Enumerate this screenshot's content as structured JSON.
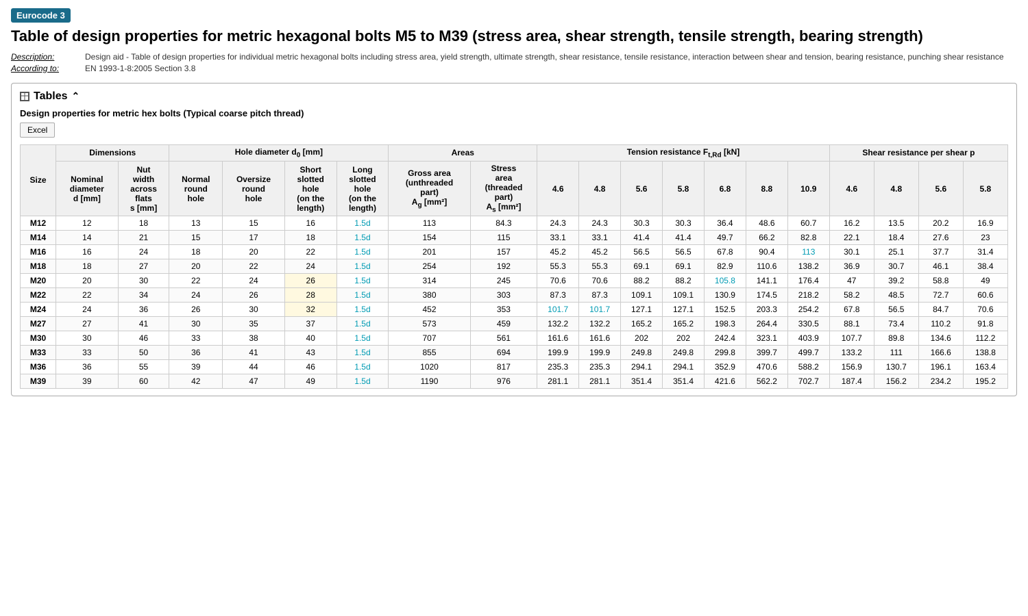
{
  "badge": "Eurocode 3",
  "title": "Table of design properties for metric hexagonal bolts M5 to M39 (stress area, shear strength, tensile strength, bearing strength)",
  "meta": {
    "description_label": "Description:",
    "description_value": "Design aid - Table of design properties for individual metric hexagonal bolts including stress area, yield strength, ultimate strength, shear resistance, tensile resistance, interaction between shear and tension, bearing resistance, punching shear resistance",
    "according_label": "According to:",
    "according_value": "EN 1993-1-8:2005 Section 3.8"
  },
  "section": {
    "header": "Tables",
    "sub_title": "Design properties for metric hex bolts (Typical coarse pitch thread)",
    "excel_button": "Excel"
  },
  "table": {
    "col_groups": [
      {
        "label": "",
        "colspan": 1
      },
      {
        "label": "Dimensions",
        "colspan": 2
      },
      {
        "label": "Hole diameter d₀ [mm]",
        "colspan": 4
      },
      {
        "label": "Areas",
        "colspan": 2
      },
      {
        "label": "Tension resistance Fₜ,Rd [kN]",
        "colspan": 7
      },
      {
        "label": "Shear resistance per shear p",
        "colspan": 4
      }
    ],
    "sub_headers": [
      "Size",
      "Nominal diameter d [mm]",
      "Nut width across flats s [mm]",
      "Normal round hole",
      "Oversize round hole",
      "Short slotted hole (on the length)",
      "Long slotted hole (on the length)",
      "Gross area (unthreaded part) Ag [mm²]",
      "Stress area (threaded part) As [mm²]",
      "4.6",
      "4.8",
      "5.6",
      "5.8",
      "6.8",
      "8.8",
      "10.9",
      "4.6",
      "4.8",
      "5.6",
      "5.8"
    ],
    "rows": [
      {
        "size": "M12",
        "d": 12,
        "s": 18,
        "normal": 13,
        "oversize": 15,
        "short": 16,
        "long": "1.5d",
        "ag": 113,
        "as_val": 84.3,
        "t46": 24.3,
        "t48": 24.3,
        "t56": 30.3,
        "t58": 30.3,
        "t68": 36.4,
        "t88": 48.6,
        "t109": 60.7,
        "s46": 16.2,
        "s48": 13.5,
        "s56": 20.2,
        "s58": 16.9,
        "t68_hl": false,
        "t109_hl": false
      },
      {
        "size": "M14",
        "d": 14,
        "s": 21,
        "normal": 15,
        "oversize": 17,
        "short": 18,
        "long": "1.5d",
        "ag": 154,
        "as_val": 115,
        "t46": 33.1,
        "t48": 33.1,
        "t56": 41.4,
        "t58": 41.4,
        "t68": 49.7,
        "t88": 66.2,
        "t109": 82.8,
        "s46": 22.1,
        "s48": 18.4,
        "s56": 27.6,
        "s58": 23.0,
        "t68_hl": false,
        "t109_hl": false
      },
      {
        "size": "M16",
        "d": 16,
        "s": 24,
        "normal": 18,
        "oversize": 20,
        "short": 22,
        "long": "1.5d",
        "ag": 201,
        "as_val": 157,
        "t46": 45.2,
        "t48": 45.2,
        "t56": 56.5,
        "t58": 56.5,
        "t68": 67.8,
        "t88": 90.4,
        "t109": 113.0,
        "s46": 30.1,
        "s48": 25.1,
        "s56": 37.7,
        "s58": 31.4,
        "t68_hl": false,
        "t109_hl": true
      },
      {
        "size": "M18",
        "d": 18,
        "s": 27,
        "normal": 20,
        "oversize": 22,
        "short": 24,
        "long": "1.5d",
        "ag": 254,
        "as_val": 192,
        "t46": 55.3,
        "t48": 55.3,
        "t56": 69.1,
        "t58": 69.1,
        "t68": 82.9,
        "t88": 110.6,
        "t109": 138.2,
        "s46": 36.9,
        "s48": 30.7,
        "s56": 46.1,
        "s58": 38.4,
        "t68_hl": false,
        "t109_hl": false
      },
      {
        "size": "M20",
        "d": 20,
        "s": 30,
        "normal": 22,
        "oversize": 24,
        "short": 26,
        "long": "1.5d",
        "ag": 314,
        "as_val": 245,
        "t46": 70.6,
        "t48": 70.6,
        "t56": 88.2,
        "t58": 88.2,
        "t68": 105.8,
        "t88": 141.1,
        "t109": 176.4,
        "s46": 47.0,
        "s48": 39.2,
        "s56": 58.8,
        "s58": 49.0,
        "t68_hl": true,
        "t109_hl": false
      },
      {
        "size": "M22",
        "d": 22,
        "s": 34,
        "normal": 24,
        "oversize": 26,
        "short": 28,
        "long": "1.5d",
        "ag": 380,
        "as_val": 303,
        "t46": 87.3,
        "t48": 87.3,
        "t56": 109.1,
        "t58": 109.1,
        "t68": 130.9,
        "t88": 174.5,
        "t109": 218.2,
        "s46": 58.2,
        "s48": 48.5,
        "s56": 72.7,
        "s58": 60.6,
        "t68_hl": false,
        "t109_hl": false
      },
      {
        "size": "M24",
        "d": 24,
        "s": 36,
        "normal": 26,
        "oversize": 30,
        "short": 32,
        "long": "1.5d",
        "ag": 452,
        "as_val": 353,
        "t46": 101.7,
        "t48": 101.7,
        "t56": 127.1,
        "t58": 127.1,
        "t68": 152.5,
        "t88": 203.3,
        "t109": 254.2,
        "s46": 67.8,
        "s48": 56.5,
        "s56": 84.7,
        "s58": 70.6,
        "t46_hl": true,
        "t48_hl": true,
        "t68_hl": false,
        "t109_hl": false
      },
      {
        "size": "M27",
        "d": 27,
        "s": 41,
        "normal": 30,
        "oversize": 35,
        "short": 37,
        "long": "1.5d",
        "ag": 573,
        "as_val": 459,
        "t46": 132.2,
        "t48": 132.2,
        "t56": 165.2,
        "t58": 165.2,
        "t68": 198.3,
        "t88": 264.4,
        "t109": 330.5,
        "s46": 88.1,
        "s48": 73.4,
        "s56": 110.2,
        "s58": 91.8,
        "t68_hl": false,
        "t109_hl": false
      },
      {
        "size": "M30",
        "d": 30,
        "s": 46,
        "normal": 33,
        "oversize": 38,
        "short": 40,
        "long": "1.5d",
        "ag": 707,
        "as_val": 561,
        "t46": 161.6,
        "t48": 161.6,
        "t56": 202.0,
        "t58": 202.0,
        "t68": 242.4,
        "t88": 323.1,
        "t109": 403.9,
        "s46": 107.7,
        "s48": 89.8,
        "s56": 134.6,
        "s58": 112.2,
        "t68_hl": false,
        "t109_hl": false
      },
      {
        "size": "M33",
        "d": 33,
        "s": 50,
        "normal": 36,
        "oversize": 41,
        "short": 43,
        "long": "1.5d",
        "ag": 855,
        "as_val": 694,
        "t46": 199.9,
        "t48": 199.9,
        "t56": 249.8,
        "t58": 249.8,
        "t68": 299.8,
        "t88": 399.7,
        "t109": 499.7,
        "s46": 133.2,
        "s48": 111.0,
        "s56": 166.6,
        "s58": 138.8,
        "t68_hl": false,
        "t109_hl": false
      },
      {
        "size": "M36",
        "d": 36,
        "s": 55,
        "normal": 39,
        "oversize": 44,
        "short": 46,
        "long": "1.5d",
        "ag": 1020,
        "as_val": 817,
        "t46": 235.3,
        "t48": 235.3,
        "t56": 294.1,
        "t58": 294.1,
        "t68": 352.9,
        "t88": 470.6,
        "t109": 588.2,
        "s46": 156.9,
        "s48": 130.7,
        "s56": 196.1,
        "s58": 163.4,
        "t68_hl": false,
        "t109_hl": false
      },
      {
        "size": "M39",
        "d": 39,
        "s": 60,
        "normal": 42,
        "oversize": 47,
        "short": 49,
        "long": "1.5d",
        "ag": 1190,
        "as_val": 976,
        "t46": 281.1,
        "t48": 281.1,
        "t56": 351.4,
        "t58": 351.4,
        "t68": 421.6,
        "t88": 562.2,
        "t109": 702.7,
        "s46": 187.4,
        "s48": 156.2,
        "s56": 234.2,
        "s58": 195.2,
        "t68_hl": false,
        "t109_hl": false
      }
    ]
  }
}
